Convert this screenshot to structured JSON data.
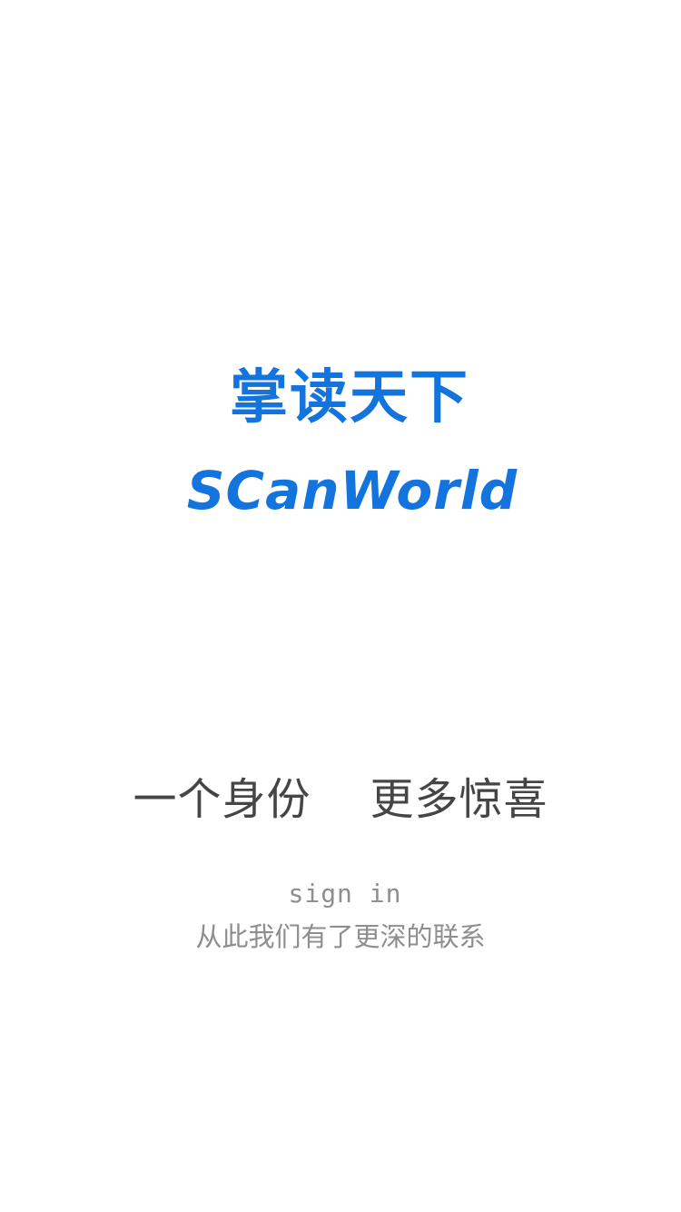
{
  "logo": {
    "title_cn": "掌读天下",
    "title_en": "SCanWorld",
    "color": "#1474de"
  },
  "slogan": "一个身份    更多惊喜",
  "signin": {
    "label": "sign in",
    "subtitle": "从此我们有了更深的联系"
  }
}
